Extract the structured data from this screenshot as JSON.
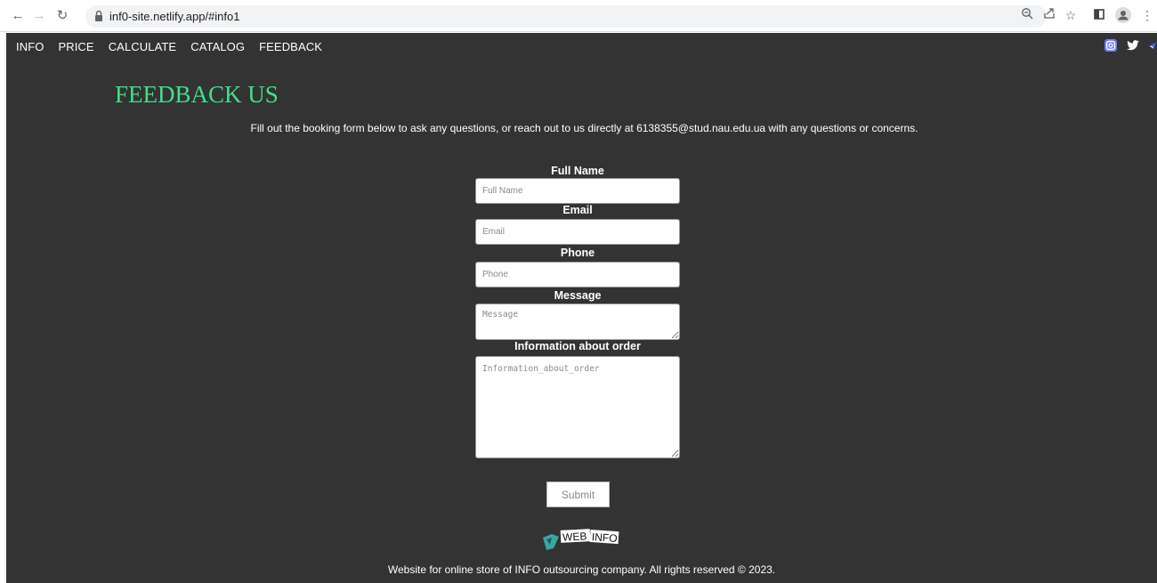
{
  "browser": {
    "url": "inf0-site.netlify.app/#info1"
  },
  "nav": {
    "items": [
      "INFO",
      "PRICE",
      "CALCULATE",
      "CATALOG",
      "FEEDBACK"
    ]
  },
  "page": {
    "title": "FEEDBACK US",
    "lead": "Fill out the booking form below to ask any questions, or reach out to us directly at 6138355@stud.nau.edu.ua with any questions or concerns."
  },
  "form": {
    "full_name_label": "Full Name",
    "full_name_placeholder": "Full Name",
    "email_label": "Email",
    "email_placeholder": "Email",
    "phone_label": "Phone",
    "phone_placeholder": "Phone",
    "message_label": "Message",
    "message_placeholder": "Message",
    "order_label": "Information about order",
    "order_placeholder": "Information_about_order",
    "submit_label": "Submit"
  },
  "logo": {
    "text_left": "WEB",
    "text_right": "INFO"
  },
  "footer": {
    "text": "Website for online store of INFO outsourcing company. All rights reserved © 2023."
  },
  "colors": {
    "site_bg": "#333333",
    "title": "#3fe08a"
  }
}
